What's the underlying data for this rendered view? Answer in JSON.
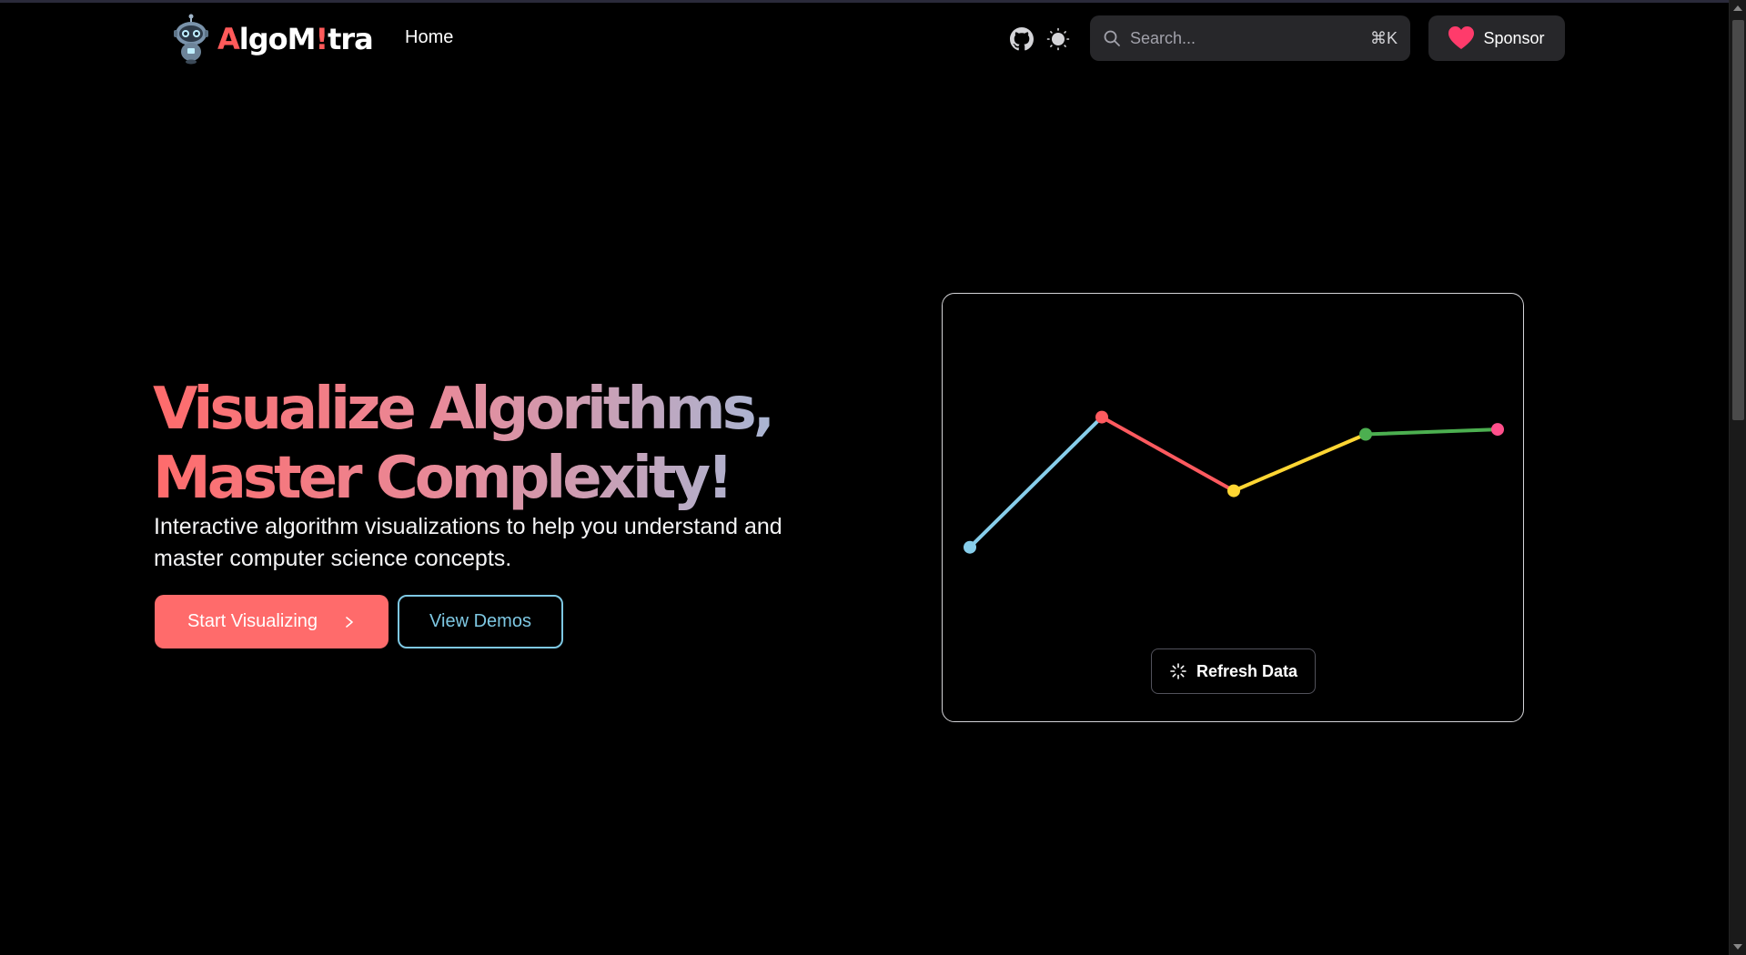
{
  "header": {
    "logo": {
      "text_a": "A",
      "text_lgo": "lgoM",
      "text_bang": "!",
      "text_tra": "tra"
    },
    "nav_home": "Home",
    "search": {
      "placeholder": "Search...",
      "shortcut": "⌘K"
    },
    "sponsor_label": "Sponsor"
  },
  "hero": {
    "title_line1": "Visualize Algorithms,",
    "title_line2": "Master Complexity!",
    "subtitle": "Interactive algorithm visualizations to help you understand and master computer science concepts.",
    "primary_button": "Start Visualizing",
    "secondary_button": "View Demos"
  },
  "chart_card": {
    "refresh_label": "Refresh Data"
  },
  "chart_data": {
    "type": "line",
    "x": [
      1,
      2,
      3,
      4,
      5
    ],
    "values": [
      19,
      72,
      42,
      65,
      67
    ],
    "ylim": [
      0,
      100
    ],
    "grid": false,
    "point_colors": [
      "#87ceeb",
      "#ff5a5f",
      "#ffd633",
      "#4caf50",
      "#ff4f8b"
    ],
    "segment_colors": [
      "#87ceeb",
      "#ff5a5f",
      "#ffd633",
      "#4caf50"
    ]
  },
  "colors": {
    "accent": "#ff6b6b",
    "outline": "#7ec8e3",
    "surface": "#27272a"
  }
}
